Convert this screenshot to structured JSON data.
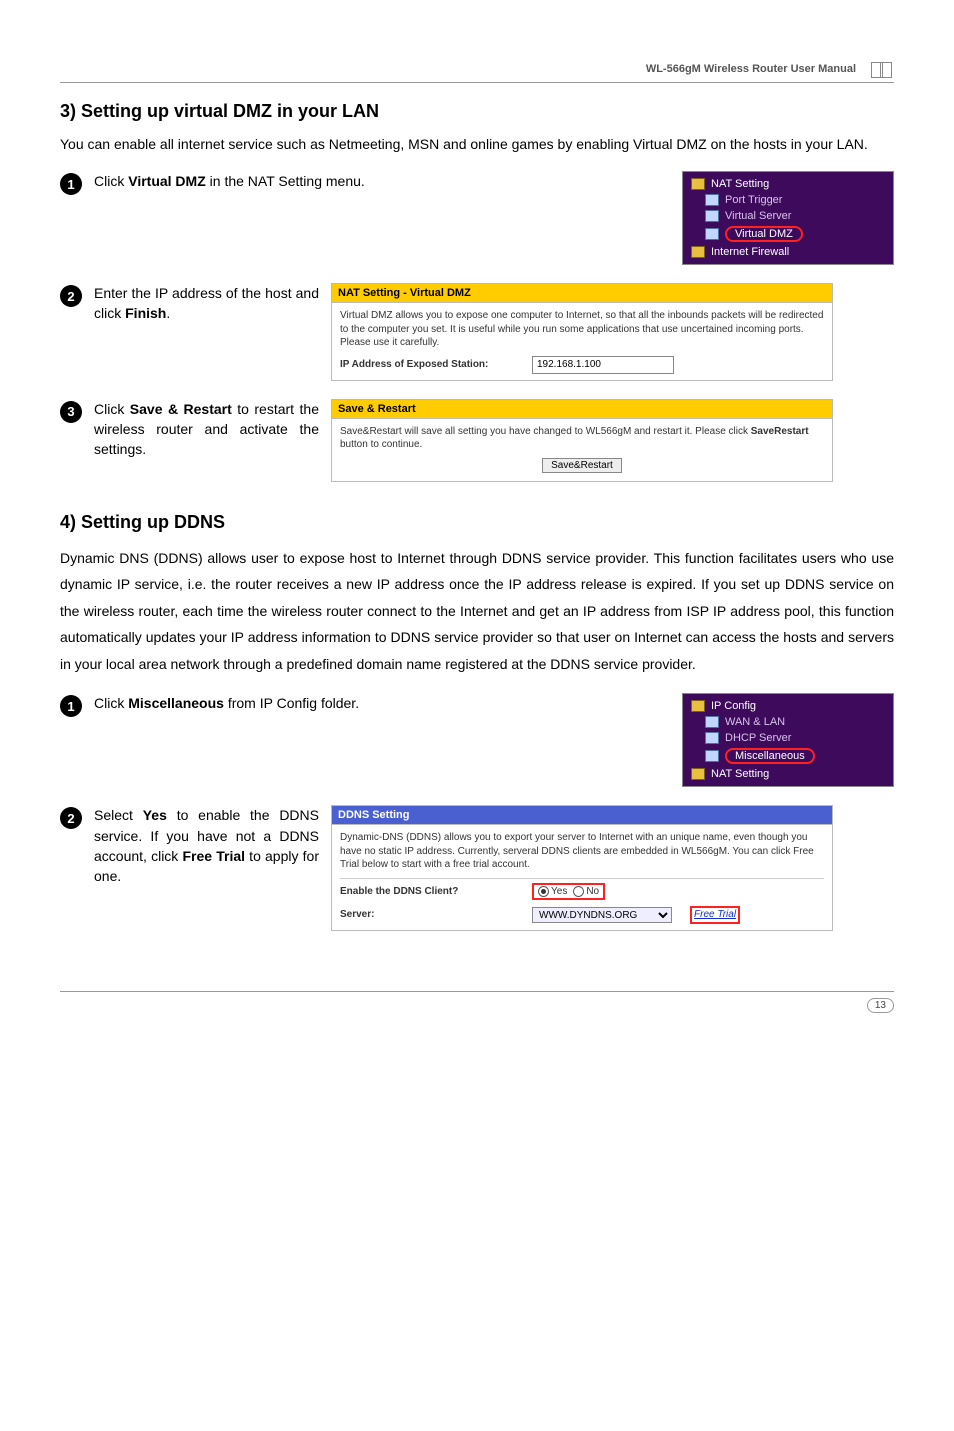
{
  "header": {
    "manual_title": "WL-566gM Wireless Router User Manual"
  },
  "section3": {
    "heading": "3) Setting up virtual DMZ in your LAN",
    "intro": "You can enable all internet service such as Netmeeting, MSN and online games by enabling Virtual DMZ on the hosts in your LAN.",
    "step1_pre": "Click ",
    "step1_bold": "Virtual DMZ",
    "step1_post": " in the NAT Setting menu.",
    "nav": {
      "items": [
        {
          "label": "NAT Setting",
          "type": "folder"
        },
        {
          "label": "Port Trigger",
          "type": "file"
        },
        {
          "label": "Virtual Server",
          "type": "file"
        },
        {
          "label": "Virtual DMZ",
          "type": "file",
          "highlight": true
        },
        {
          "label": "Internet Firewall",
          "type": "folder"
        }
      ]
    },
    "step2_pre": "Enter the IP address of the host and click ",
    "step2_bold": "Finish",
    "step2_post": ".",
    "panel_nat": {
      "title": "NAT Setting - Virtual DMZ",
      "desc": "Virtual DMZ allows you to expose one computer to Internet, so that all the inbounds packets will be redirected to the computer you set. It is useful while you run some applications that use uncertained incoming ports. Please use it carefully.",
      "field_label": "IP Address of Exposed Station:",
      "field_value": "192.168.1.100"
    },
    "step3_pre": "Click ",
    "step3_bold": "Save & Restart",
    "step3_post": " to restart the wireless router and activate the settings.",
    "panel_save": {
      "title": "Save & Restart",
      "desc_pre": "Save&Restart will save all setting you have changed to WL566gM and restart it. Please click ",
      "desc_bold": "SaveRestart",
      "desc_post": " button to continue.",
      "button": "Save&Restart"
    }
  },
  "section4": {
    "heading": "4) Setting up DDNS",
    "intro": "Dynamic DNS (DDNS) allows user to expose host to Internet through DDNS service provider. This function facilitates users who use dynamic IP service, i.e. the router receives a new IP address once the IP address release is expired. If you set up DDNS service on the wireless router, each time the wireless router connect to the Internet and get an IP address from ISP IP address pool, this function automatically updates your IP address information to DDNS service provider so that user on Internet can access the hosts and servers in your local area network through a predefined domain name registered at the DDNS service provider.",
    "step1_pre": "Click ",
    "step1_bold": "Miscellaneous",
    "step1_post": " from IP Config folder.",
    "nav": {
      "items": [
        {
          "label": "IP Config",
          "type": "folder"
        },
        {
          "label": "WAN & LAN",
          "type": "file"
        },
        {
          "label": "DHCP Server",
          "type": "file"
        },
        {
          "label": "Miscellaneous",
          "type": "file",
          "highlight": true
        },
        {
          "label": "NAT Setting",
          "type": "folder"
        }
      ]
    },
    "step2_pre": "Select ",
    "step2_bold1": "Yes",
    "step2_mid1": " to enable the DDNS service. If you have not a DDNS account, click ",
    "step2_bold2": "Free Trial",
    "step2_post": " to apply for one.",
    "panel_ddns": {
      "title": "DDNS Setting",
      "desc": "Dynamic-DNS (DDNS) allows you to export your server to Internet with an unique name, even though you have no static IP address. Currently, serveral DDNS clients are embedded in WL566gM. You can click Free Trial below to start with a free trial account.",
      "enable_label": "Enable the DDNS Client?",
      "yes": "Yes",
      "no": "No",
      "server_label": "Server:",
      "server_value": "WWW.DYNDNS.ORG",
      "free_trial": "Free Trial"
    }
  },
  "footer": {
    "page": "13"
  }
}
